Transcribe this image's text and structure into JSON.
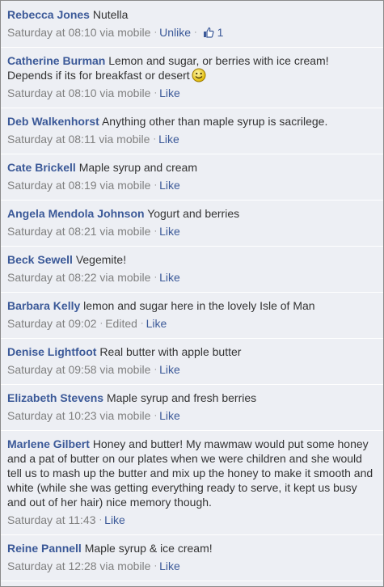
{
  "comments": [
    {
      "author": "Rebecca Jones",
      "text": "Nutella",
      "time": "Saturday at 08:10",
      "via": "via mobile",
      "action": "Unlike",
      "likes": "1"
    },
    {
      "author": "Catherine Burman",
      "text": "Lemon and sugar, or berries with ice cream! Depends if its for breakfast or desert",
      "time": "Saturday at 08:10",
      "via": "via mobile",
      "action": "Like"
    },
    {
      "author": "Deb Walkenhorst",
      "text": "Anything other than maple syrup is sacrilege.",
      "time": "Saturday at 08:11",
      "via": "via mobile",
      "action": "Like"
    },
    {
      "author": "Cate Brickell",
      "text": "Maple syrup and cream",
      "time": "Saturday at 08:19",
      "via": "via mobile",
      "action": "Like"
    },
    {
      "author": "Angela Mendola Johnson",
      "text": "Yogurt and berries",
      "time": "Saturday at 08:21",
      "via": "via mobile",
      "action": "Like"
    },
    {
      "author": "Beck Sewell",
      "text": "Vegemite!",
      "time": "Saturday at 08:22",
      "via": "via mobile",
      "action": "Like"
    },
    {
      "author": "Barbara Kelly",
      "text": "lemon and sugar here in the lovely Isle of Man",
      "time": "Saturday at 09:02",
      "via": "Edited",
      "action": "Like"
    },
    {
      "author": "Denise Lightfoot",
      "text": "Real butter with apple butter",
      "time": "Saturday at 09:58",
      "via": "via mobile",
      "action": "Like"
    },
    {
      "author": "Elizabeth Stevens",
      "text": "Maple syrup and fresh berries",
      "time": "Saturday at 10:23",
      "via": "via mobile",
      "action": "Like"
    },
    {
      "author": "Marlene Gilbert",
      "text": "Honey and butter! My mawmaw would put some honey and a pat of butter on our plates when we were children and she would tell us to mash up the butter and mix up the honey to make it smooth and white (while she was getting everything ready to serve, it kept us busy and out of her hair) nice memory though.",
      "time": "Saturday at 11:43",
      "action": "Like"
    },
    {
      "author": "Reine Pannell",
      "text": "Maple syrup & ice cream!",
      "time": "Saturday at 12:28",
      "via": "via mobile",
      "action": "Like"
    }
  ],
  "icons": {
    "thumb": "thumbs-up-icon",
    "smiley": "smiley-icon"
  },
  "colors": {
    "name_link": "#3b5998",
    "background": "#edeff4",
    "meta": "#808080",
    "text": "#333333"
  }
}
